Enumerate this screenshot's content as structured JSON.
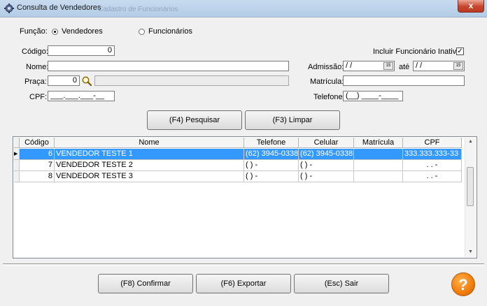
{
  "window": {
    "title": "Consulta de Vendedores",
    "ghost_title": "Cadastro de Funcionários",
    "close_label": "x"
  },
  "funcao": {
    "label": "Função:",
    "options": [
      "Vendedores",
      "Funcionários"
    ],
    "selected": "Vendedores"
  },
  "codigo": {
    "label": "Código:",
    "value": "0"
  },
  "nome": {
    "label": "Nome:",
    "value": ""
  },
  "praca": {
    "label": "Praça:",
    "value": "0",
    "description": ""
  },
  "cpf": {
    "label": "CPF:",
    "value": "___.___.___-__"
  },
  "incluir_inativo": {
    "label": "Incluir Funcionário Inativo:",
    "checked": true,
    "mark": "✓"
  },
  "admissao": {
    "label": "Admissão:",
    "from": "/ /",
    "to_label": "até",
    "to": "/ /",
    "cal_label": "15"
  },
  "matricula": {
    "label": "Matrícula:",
    "value": ""
  },
  "telefone": {
    "label": "Telefone:",
    "value": "(__) ____-____"
  },
  "buttons": {
    "pesquisar": "(F4) Pesquisar",
    "limpar": "(F3) Limpar",
    "confirmar": "(F8) Confirmar",
    "exportar": "(F6) Exportar",
    "sair": "(Esc) Sair",
    "help": "?"
  },
  "grid": {
    "columns": [
      "Código",
      "Nome",
      "Telefone",
      "Celular",
      "Matrícula",
      "CPF"
    ],
    "rows": [
      {
        "codigo": "6",
        "nome": "VENDEDOR TESTE 1",
        "telefone": "(62) 3945-0338",
        "celular": "(62) 3945-0338",
        "matricula": "",
        "cpf": "333.333.333-33",
        "selected": true
      },
      {
        "codigo": "7",
        "nome": "VENDEDOR TESTE 2",
        "telefone": "( ) -",
        "celular": "( ) -",
        "matricula": "",
        "cpf": ". . -",
        "selected": false
      },
      {
        "codigo": "8",
        "nome": "VENDEDOR TESTE 3",
        "telefone": "( ) -",
        "celular": "( ) -",
        "matricula": "",
        "cpf": ". . -",
        "selected": false
      }
    ],
    "row_indicator": "▶"
  },
  "colors": {
    "selection": "#3399ff",
    "help": "#f07d0a",
    "close": "#c7452d"
  }
}
